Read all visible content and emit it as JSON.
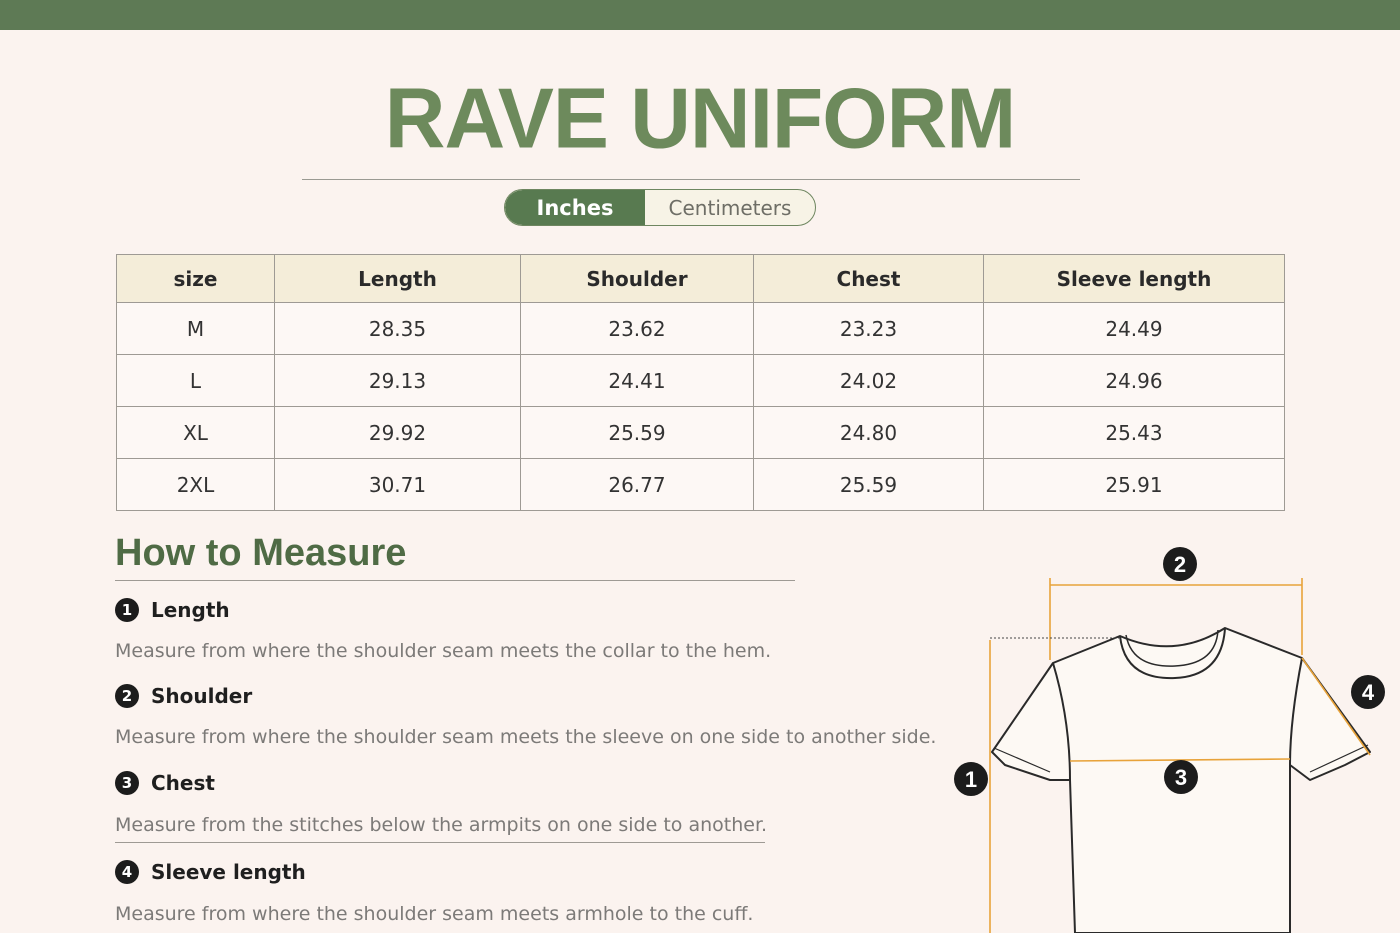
{
  "header": {
    "title": "RAVE UNIFORM"
  },
  "unit_toggle": {
    "active": "Inches",
    "inactive": "Centimeters"
  },
  "table": {
    "headers": [
      "size",
      "Length",
      "Shoulder",
      "Chest",
      "Sleeve length"
    ],
    "rows": [
      [
        "M",
        "28.35",
        "23.62",
        "23.23",
        "24.49"
      ],
      [
        "L",
        "29.13",
        "24.41",
        "24.02",
        "24.96"
      ],
      [
        "XL",
        "29.92",
        "25.59",
        "24.80",
        "25.43"
      ],
      [
        "2XL",
        "30.71",
        "26.77",
        "25.59",
        "25.91"
      ]
    ]
  },
  "measure": {
    "title": "How to Measure",
    "steps": [
      {
        "num": "1",
        "label": "Length",
        "desc": "Measure from where the shoulder seam meets the collar to the hem."
      },
      {
        "num": "2",
        "label": "Shoulder",
        "desc": "Measure from where the shoulder seam meets the sleeve on one side to another side."
      },
      {
        "num": "3",
        "label": "Chest",
        "desc": "Measure from the stitches below the armpits on one side to another."
      },
      {
        "num": "4",
        "label": "Sleeve length",
        "desc": "Measure from where the shoulder seam meets armhole to the cuff."
      }
    ]
  },
  "diagram": {
    "markers": [
      "1",
      "2",
      "3",
      "4"
    ]
  },
  "colors": {
    "accent": "#5e7a55",
    "title": "#6d8a5c",
    "guide": "#e8a33a"
  }
}
